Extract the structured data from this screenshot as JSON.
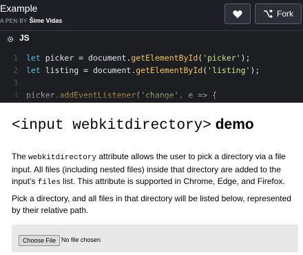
{
  "header": {
    "pen_title": "Example",
    "author_prefix": "A PEN BY",
    "author_name": "Šime Vidas",
    "fork_label": "Fork"
  },
  "code_panel": {
    "lang": "JS",
    "lines": [
      {
        "num": "1",
        "parts": [
          [
            "kw",
            "let "
          ],
          [
            "",
            "picker = document."
          ],
          [
            "fn",
            "getElementById"
          ],
          [
            "",
            "("
          ],
          [
            "str",
            "'picker'"
          ],
          [
            "",
            ");"
          ]
        ]
      },
      {
        "num": "2",
        "parts": [
          [
            "kw",
            "let "
          ],
          [
            "",
            "listing = document."
          ],
          [
            "fn",
            "getElementById"
          ],
          [
            "",
            "("
          ],
          [
            "str",
            "'listing'"
          ],
          [
            "",
            ");"
          ]
        ]
      },
      {
        "num": "3",
        "parts": []
      },
      {
        "num": "4",
        "parts": [
          [
            "",
            "picker."
          ],
          [
            "fn",
            "addEventListener"
          ],
          [
            "",
            "("
          ],
          [
            "str",
            "'change'"
          ],
          [
            "",
            ", e => {"
          ]
        ]
      }
    ]
  },
  "result": {
    "heading_mono": "<input webkitdirectory>",
    "heading_bold": "demo",
    "para1_prefix": "The ",
    "para1_code1": "webkitdirectory",
    "para1_mid": " attribute allows the user to pick a directory via a file input. All files (including nested files) inside that directory are added to the input’s ",
    "para1_code2": "files",
    "para1_suffix": " list. This attribute is supported in Chrome, Edge, and Firefox.",
    "para2": "Pick a directory, and all files in that directory will be listed below, represented by their relative path.",
    "choose_button": "Choose File",
    "no_file": "No file chosen"
  }
}
